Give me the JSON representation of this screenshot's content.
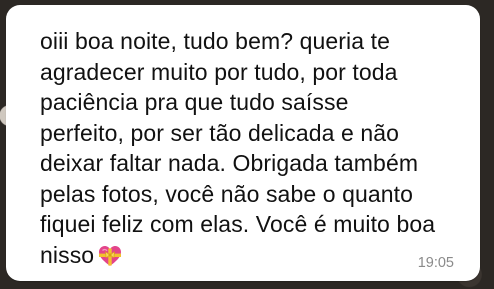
{
  "message": {
    "lines": [
      "oiii boa noite, tudo bem? queria te",
      "agradecer muito por tudo, por toda",
      "paciência pra que tudo saísse",
      "perfeito, por ser tão delicada e não",
      "deixar faltar nada. Obrigada também",
      "pelas fotos, você não sabe o quanto",
      "fiquei feliz com elas. Você é muito boa",
      "nisso"
    ],
    "emoji": "heart-with-ribbon-icon",
    "timestamp": "19:05"
  },
  "colors": {
    "bubble": "#ffffff",
    "text": "#111111",
    "timestamp": "#8a8a8a",
    "heart": "#e3458a",
    "ribbon": "#f2c12e"
  }
}
